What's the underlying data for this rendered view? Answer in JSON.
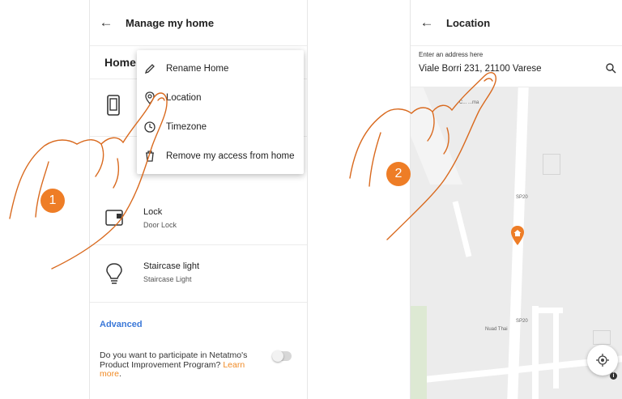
{
  "screen1": {
    "header": {
      "back_icon": "arrow-left-icon",
      "title": "Manage my home"
    },
    "home_title": "Home",
    "menu": {
      "items": [
        {
          "label": "Rename Home",
          "icon": "pencil-icon"
        },
        {
          "label": "Location",
          "icon": "location-pin-icon"
        },
        {
          "label": "Timezone",
          "icon": "clock-icon"
        },
        {
          "label": "Remove my access from home",
          "icon": "trash-icon"
        }
      ]
    },
    "devices": [
      {
        "name": "Lock",
        "type": "Door Lock",
        "icon": "lock-device-icon"
      },
      {
        "name": "Staircase light",
        "type": "Staircase Light",
        "icon": "light-bulb-icon"
      }
    ],
    "advanced_label": "Advanced",
    "consent": {
      "text": "Do you want to participate in Netatmo's Product Improvement Program?",
      "link": "Learn more",
      "suffix": ".",
      "enabled": false
    },
    "step_badge": "1"
  },
  "screen2": {
    "header": {
      "back_icon": "arrow-left-icon",
      "title": "Location"
    },
    "address": {
      "label": "Enter an address here",
      "value": "Viale Borri 231, 21100 Varese",
      "search_icon": "search-icon"
    },
    "map": {
      "labels": {
        "road1": "SP20",
        "road2": "SP20",
        "place1": "Nuad Thai",
        "place2": "C... ...ma"
      },
      "pin_icon": "home-pin-icon",
      "locate_icon": "my-location-icon",
      "info_icon": "info-icon"
    },
    "step_badge": "2"
  },
  "colors": {
    "accent": "#ee7d26",
    "link": "#3b78d8",
    "map_bg": "#ececec"
  }
}
